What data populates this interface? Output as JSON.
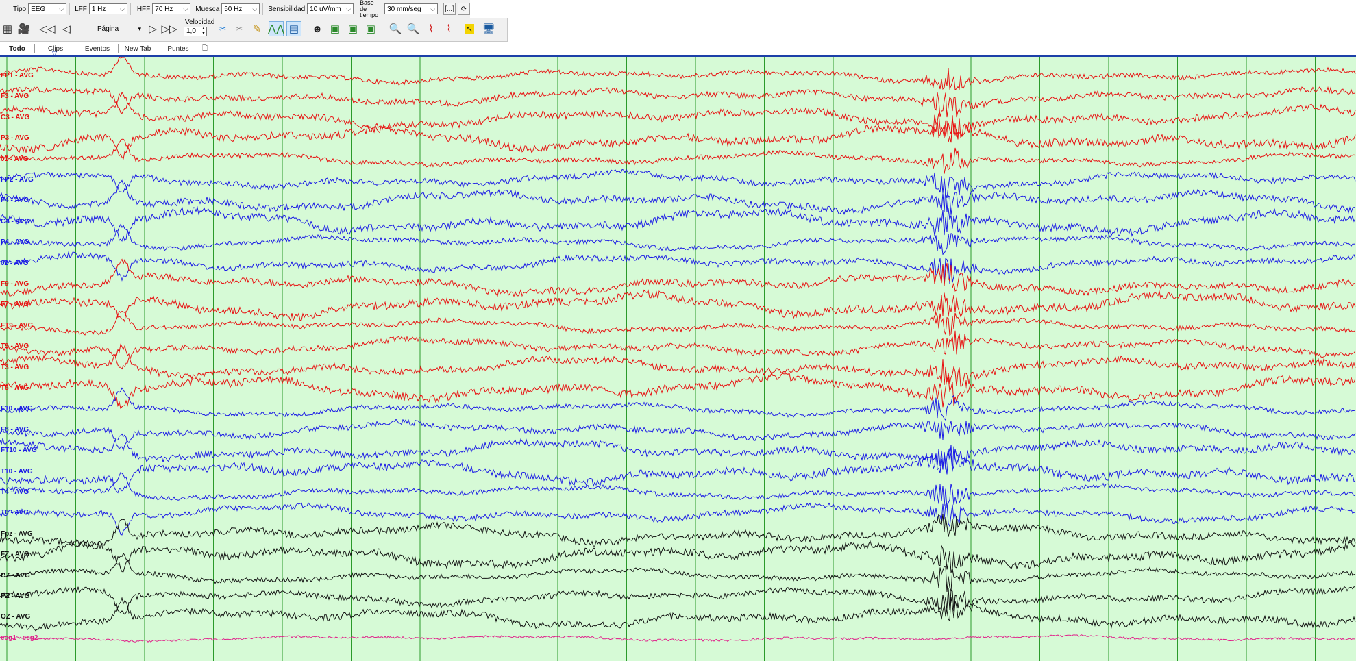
{
  "toolbar": {
    "tipo_label": "Tipo",
    "tipo_value": "EEG",
    "lff_label": "LFF",
    "lff_value": "1 Hz",
    "hff_label": "HFF",
    "hff_value": "70 Hz",
    "muesca_label": "Muesca",
    "muesca_value": "50 Hz",
    "sensibilidad_label": "Sensibilidad",
    "sensibilidad_value": "10 uV/mm",
    "base_label_1": "Base de",
    "base_label_2": "tiempo",
    "base_value": "30 mm/seg",
    "bracket_button": "[...]",
    "refresh_icon": "refresh-icon"
  },
  "toolbar2": {
    "pagina_label": "Página",
    "velocidad_label": "Velocidad",
    "velocidad_value": "1,0"
  },
  "tabs": [
    {
      "label": "Todo"
    },
    {
      "label": "Clips"
    },
    {
      "label": "Eventos"
    },
    {
      "label": "New Tab"
    },
    {
      "label": "Puntes"
    }
  ],
  "channels": [
    {
      "label": "FP1 - AVG",
      "color": "#e81010"
    },
    {
      "label": "F3 - AVG",
      "color": "#e81010"
    },
    {
      "label": "C3 - AVG",
      "color": "#e81010"
    },
    {
      "label": "P3 - AVG",
      "color": "#e81010"
    },
    {
      "label": "01 - AVG",
      "color": "#e81010"
    },
    {
      "label": "FP2 - AVG",
      "color": "#1a1ae6"
    },
    {
      "label": "F4 - AVG",
      "color": "#1a1ae6"
    },
    {
      "label": "C4 - AVG",
      "color": "#1a1ae6"
    },
    {
      "label": "P4 - AVG",
      "color": "#1a1ae6"
    },
    {
      "label": "02 - AVG",
      "color": "#1a1ae6"
    },
    {
      "label": "F9 - AVG",
      "color": "#e81010"
    },
    {
      "label": "F7 - AVG",
      "color": "#e81010"
    },
    {
      "label": "FT9 - AVG",
      "color": "#e81010"
    },
    {
      "label": "T9 - AVG",
      "color": "#e81010"
    },
    {
      "label": "T3 - AVG",
      "color": "#e81010"
    },
    {
      "label": "T5 - AVG",
      "color": "#e81010"
    },
    {
      "label": "F10 - AVG",
      "color": "#1a1ae6"
    },
    {
      "label": "F8 - AVG",
      "color": "#1a1ae6"
    },
    {
      "label": "FT10 - AVG",
      "color": "#1a1ae6"
    },
    {
      "label": "T10 - AVG",
      "color": "#1a1ae6"
    },
    {
      "label": "T4 - AVG",
      "color": "#1a1ae6"
    },
    {
      "label": "T6 - AVG",
      "color": "#1a1ae6"
    },
    {
      "label": "Fpz - AVG",
      "color": "#111111"
    },
    {
      "label": "FZ - AVG",
      "color": "#111111"
    },
    {
      "label": "CZ - AVG",
      "color": "#111111"
    },
    {
      "label": "PZ - AVG",
      "color": "#111111"
    },
    {
      "label": "OZ - AVG",
      "color": "#111111"
    },
    {
      "label": "ecg1 - ecg2",
      "color": "#e0208a"
    }
  ],
  "colors": {
    "background": "#d6fad6",
    "gridline": "#2a9a2a",
    "accent_bar": "#1c3fa8"
  }
}
